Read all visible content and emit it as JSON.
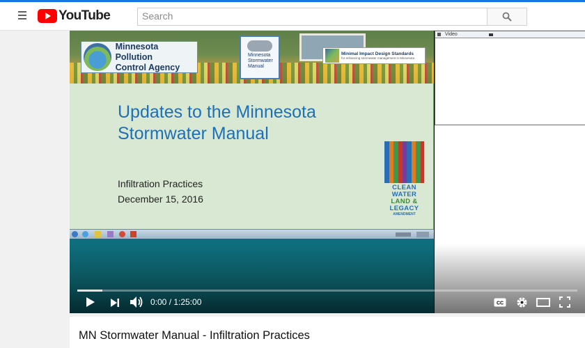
{
  "masthead": {
    "logo_text": "YouTube",
    "search_placeholder": "Search"
  },
  "slide": {
    "agency_name_line1": "Minnesota Pollution",
    "agency_name_line2": "Control Agency",
    "manual_line1": "Minnesota",
    "manual_line2": "Stormwater",
    "manual_line3": "Manual",
    "mids_title": "Minimal Impact Design Standards",
    "mids_subtitle": "for enhancing stormwater management in Minnesota",
    "title": "Updates to the Minnesota Stormwater Manual",
    "subtitle_line1": "Infiltration Practices",
    "subtitle_line2": "December 15, 2016",
    "clean_logo": {
      "line1": "CLEAN",
      "line2": "WATER",
      "line3": "LAND &",
      "line4": "LEGACY",
      "line5": "AMENDMENT"
    }
  },
  "side_panel": {
    "video_label": "Video"
  },
  "player": {
    "current_time": "0:00 / 1:25:00",
    "progress_fraction": 0.05
  },
  "video": {
    "title": "MN Stormwater Manual - Infiltration Practices"
  }
}
